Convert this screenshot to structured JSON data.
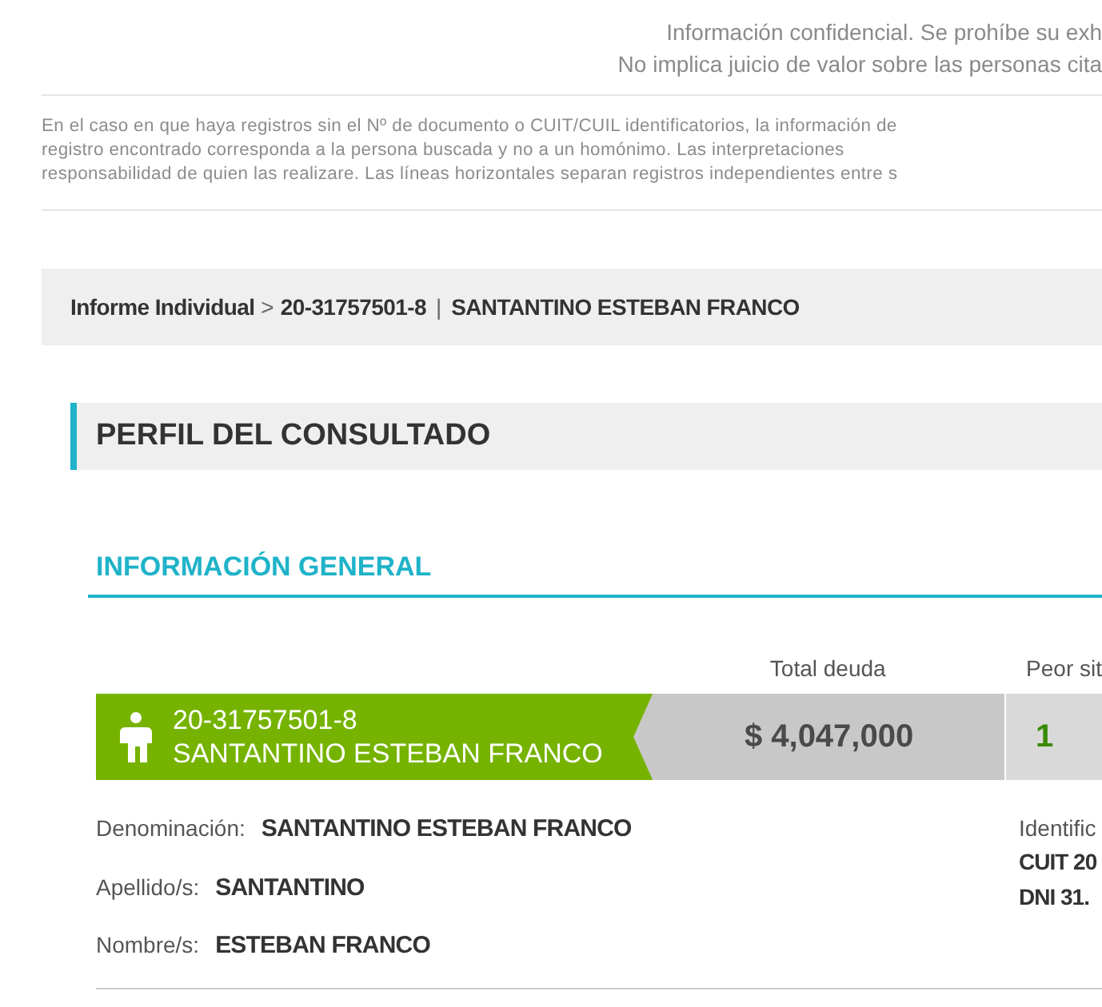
{
  "notice": [
    "Información confidencial. Se prohíbe su exh",
    "No implica juicio de valor sobre las personas cita"
  ],
  "disclaimer": [
    "En el caso en que haya registros sin el Nº de documento o CUIT/CUIL identificatorios, la información de",
    "registro encontrado corresponda a la persona buscada y no a un homónimo. Las interpretaciones",
    "responsabilidad de quien las realizare. Las líneas horizontales separan registros independientes entre s"
  ],
  "breadcrumb": {
    "root": "Informe Individual",
    "separator": ">",
    "id": "20-31757501-8",
    "divider": "|",
    "name": "SANTANTINO ESTEBAN FRANCO"
  },
  "section_title": "PERFIL DEL CONSULTADO",
  "subsection_title": "INFORMACIÓN GENERAL",
  "summary": {
    "columns": [
      "Total deuda",
      "Peor sit"
    ],
    "id": "20-31757501-8",
    "name": "SANTANTINO ESTEBAN FRANCO",
    "total_debt": "$ 4,047,000",
    "worst_situation": "1"
  },
  "details": [
    {
      "label": "Denominación:",
      "value": "SANTANTINO ESTEBAN FRANCO"
    },
    {
      "label": "Apellido/s:",
      "value": "SANTANTINO"
    },
    {
      "label": "Nombre/s:",
      "value": "ESTEBAN FRANCO"
    }
  ],
  "identification": {
    "label": "Identific",
    "lines": [
      "CUIT 20",
      "DNI 31."
    ]
  }
}
